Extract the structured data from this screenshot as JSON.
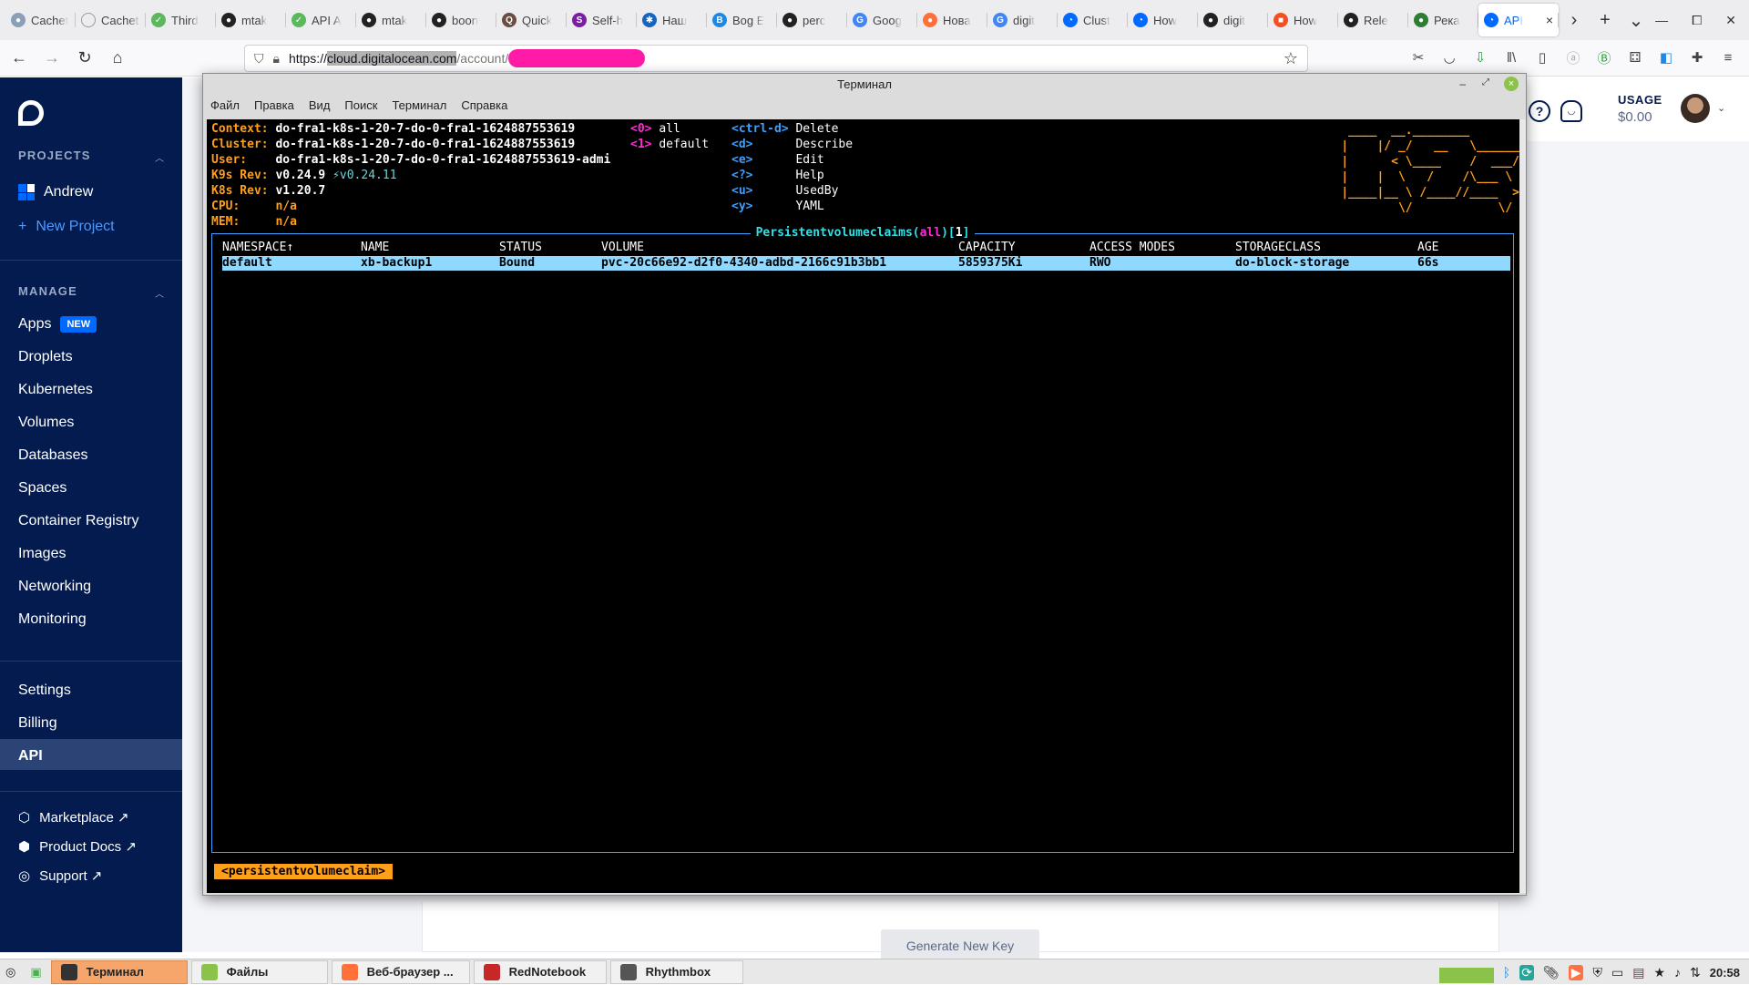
{
  "browser": {
    "tabs": [
      {
        "title": "Cachet",
        "icon": "cachet-icon",
        "color": "#8aa0b8",
        "glyph": "●"
      },
      {
        "title": "Cachet: T",
        "icon": "blank-page-icon",
        "color": "#ededf0",
        "glyph": ""
      },
      {
        "title": "Third",
        "icon": "check-icon",
        "color": "#5cb85c",
        "glyph": "✓"
      },
      {
        "title": "mtak",
        "icon": "github-icon",
        "color": "#222222",
        "glyph": "●"
      },
      {
        "title": "API A",
        "icon": "check-icon",
        "color": "#5cb85c",
        "glyph": "✓"
      },
      {
        "title": "mtak",
        "icon": "github-icon",
        "color": "#222222",
        "glyph": "●"
      },
      {
        "title": "boon",
        "icon": "github-icon",
        "color": "#222222",
        "glyph": "●"
      },
      {
        "title": "Quick",
        "icon": "quick-icon",
        "color": "#6d4c41",
        "glyph": "Q"
      },
      {
        "title": "Self-h",
        "icon": "self-hosted-icon",
        "color": "#7b1fa2",
        "glyph": "S"
      },
      {
        "title": "Наш",
        "icon": "star-box-icon",
        "color": "#1565c0",
        "glyph": "✱"
      },
      {
        "title": "Bog E",
        "icon": "bb-icon",
        "color": "#1e88e5",
        "glyph": "B"
      },
      {
        "title": "perc",
        "icon": "github-icon",
        "color": "#222222",
        "glyph": "●"
      },
      {
        "title": "Goog",
        "icon": "google-translate-icon",
        "color": "#4285f4",
        "glyph": "G"
      },
      {
        "title": "Нова",
        "icon": "firefox-icon",
        "color": "#ff7139",
        "glyph": "●"
      },
      {
        "title": "digit",
        "icon": "google-icon",
        "color": "#4285f4",
        "glyph": "G"
      },
      {
        "title": "Clust",
        "icon": "digitalocean-icon",
        "color": "#0069ff",
        "glyph": "◔"
      },
      {
        "title": "How",
        "icon": "digitalocean-icon",
        "color": "#0069ff",
        "glyph": "◔"
      },
      {
        "title": "digit",
        "icon": "github-icon",
        "color": "#222222",
        "glyph": "●"
      },
      {
        "title": "How",
        "icon": "microsoft-icon",
        "color": "#f25022",
        "glyph": "■"
      },
      {
        "title": "Rele",
        "icon": "github-icon",
        "color": "#222222",
        "glyph": "●"
      },
      {
        "title": "Река",
        "icon": "green-pin-icon",
        "color": "#2e7d32",
        "glyph": "●"
      },
      {
        "title": "API",
        "icon": "digitalocean-icon",
        "color": "#0069ff",
        "glyph": "◔",
        "active": true
      }
    ],
    "url_host": "cloud.digitalocean.com",
    "url_path": "/account/a",
    "url_scheme": "https://"
  },
  "sidebar": {
    "projects_header": "PROJECTS",
    "project_name": "Andrew",
    "new_project": "New Project",
    "manage_header": "MANAGE",
    "manage_items": [
      "Apps",
      "Droplets",
      "Kubernetes",
      "Volumes",
      "Databases",
      "Spaces",
      "Container Registry",
      "Images",
      "Networking",
      "Monitoring"
    ],
    "new_badge": "NEW",
    "settings_items": [
      "Settings",
      "Billing",
      "API"
    ],
    "active_item": "API",
    "external_links": [
      "Marketplace ↗",
      "Product Docs ↗",
      "Support ↗"
    ]
  },
  "header": {
    "usage_label": "USAGE",
    "usage_value": "$0.00"
  },
  "page": {
    "generate_key_button": "Generate New Key"
  },
  "terminal": {
    "title": "Терминал",
    "menu": [
      "Файл",
      "Правка",
      "Вид",
      "Поиск",
      "Терминал",
      "Справка"
    ],
    "info": [
      {
        "label": "Context:",
        "value": "do-fra1-k8s-1-20-7-do-0-fra1-1624887553619"
      },
      {
        "label": "Cluster:",
        "value": "do-fra1-k8s-1-20-7-do-0-fra1-1624887553619"
      },
      {
        "label": "User:",
        "value": "do-fra1-k8s-1-20-7-do-0-fra1-1624887553619-admi"
      },
      {
        "label": "K9s Rev:",
        "value": "v0.24.9",
        "extra": "⚡v0.24.11"
      },
      {
        "label": "K8s Rev:",
        "value": "v1.20.7"
      },
      {
        "label": "CPU:",
        "value": "n/a"
      },
      {
        "label": "MEM:",
        "value": "n/a"
      }
    ],
    "namespaces": [
      {
        "key": "<0>",
        "name": "all"
      },
      {
        "key": "<1>",
        "name": "default"
      }
    ],
    "hotkeys": [
      {
        "key": "<ctrl-d>",
        "action": "Delete"
      },
      {
        "key": "<d>",
        "action": "Describe"
      },
      {
        "key": "<e>",
        "action": "Edit"
      },
      {
        "key": "<?>",
        "action": "Help"
      },
      {
        "key": "<u>",
        "action": "UsedBy"
      },
      {
        "key": "<y>",
        "action": "YAML"
      }
    ],
    "logo_lines": [
      " ____  __.________       ",
      "|    |/ _/   __   \\______",
      "|      < \\____    /  ___/",
      "|    |  \\   /    /\\___ \\ ",
      "|____|__ \\ /____//____  >",
      "        \\/            \\/ "
    ],
    "pane_title_resource": "Persistentvolumeclaims",
    "pane_title_ns": "all",
    "pane_title_count": "1",
    "columns": [
      "NAMESPACE↑",
      "NAME",
      "STATUS",
      "VOLUME",
      "CAPACITY",
      "ACCESS MODES",
      "STORAGECLASS",
      "AGE"
    ],
    "rows": [
      [
        "default",
        "xb-backup1",
        "Bound",
        "pvc-20c66e92-d2f0-4340-adbd-2166c91b3bb1",
        "5859375Ki",
        "RWO",
        "do-block-storage",
        "66s"
      ]
    ],
    "crumb": "<persistentvolumeclaim>"
  },
  "taskbar": {
    "apps": [
      {
        "label": "Терминал",
        "icon": "terminal-icon",
        "color": "#333333",
        "active": true
      },
      {
        "label": "Файлы",
        "icon": "folder-icon",
        "color": "#8bc34a"
      },
      {
        "label": "Веб-браузер ...",
        "icon": "firefox-icon",
        "color": "#ff7139"
      },
      {
        "label": "RedNotebook",
        "icon": "notebook-icon",
        "color": "#c62828"
      },
      {
        "label": "Rhythmbox",
        "icon": "music-icon",
        "color": "#555555"
      }
    ],
    "clock": "20:58"
  }
}
